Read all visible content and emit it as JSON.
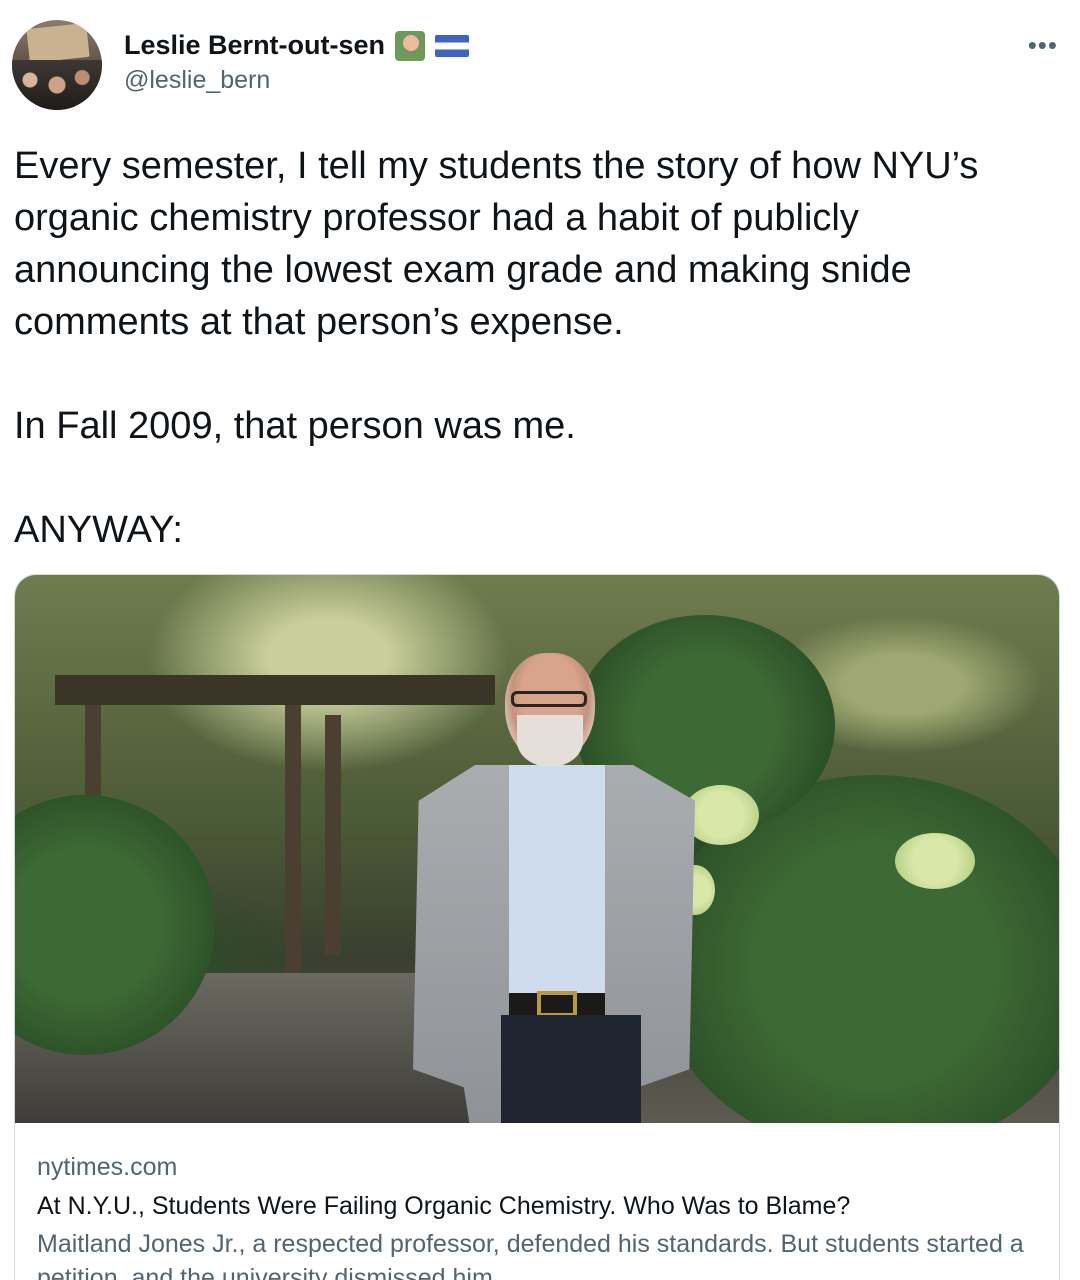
{
  "author": {
    "name": "Leslie Bernt-out-sen",
    "handle": "@leslie_bern",
    "name_badges": [
      "teacher-emoji",
      "nicaragua-flag-emoji"
    ]
  },
  "more_label": "•••",
  "tweet": {
    "paragraphs": [
      "Every semester, I tell my students the story of how NYU’s organic chemistry professor had a habit of publicly announcing the lowest exam grade and making snide comments at that person’s expense.",
      "In Fall 2009, that person was me.",
      "ANYWAY:"
    ]
  },
  "link_card": {
    "domain": "nytimes.com",
    "title": "At N.Y.U., Students Were Failing Organic Chemistry. Who Was to Blame?",
    "description": "Maitland Jones Jr., a respected professor, defended his standards. But students started a petition, and the university dismissed him."
  },
  "colors": {
    "text_primary": "#0f1419",
    "text_secondary": "#536471",
    "card_border": "#cfd9de"
  }
}
